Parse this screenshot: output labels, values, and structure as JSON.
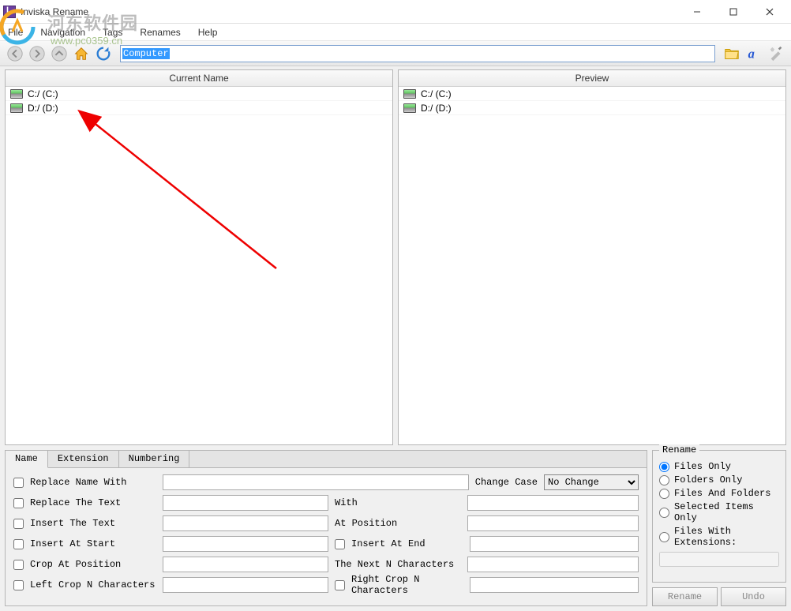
{
  "window": {
    "title": "Inviska Rename"
  },
  "menu": {
    "file": "File",
    "navigation": "Navigation",
    "tags": "Tags",
    "renames": "Renames",
    "help": "Help"
  },
  "toolbar": {
    "path_value": "Computer"
  },
  "panes": {
    "left_header": "Current Name",
    "right_header": "Preview",
    "drives": [
      {
        "label": "C:/ (C:)"
      },
      {
        "label": "D:/ (D:)"
      }
    ]
  },
  "tabs": {
    "name": "Name",
    "extension": "Extension",
    "numbering": "Numbering"
  },
  "name_tab": {
    "replace_name_with": "Replace Name With",
    "change_case": "Change Case",
    "change_case_value": "No Change",
    "replace_the_text": "Replace The Text",
    "with": "With",
    "insert_the_text": "Insert The Text",
    "at_position": "At Position",
    "insert_at_start": "Insert At Start",
    "insert_at_end": "Insert At End",
    "crop_at_position": "Crop At Position",
    "the_next_n": "The Next N Characters",
    "left_crop_n": "Left Crop N Characters",
    "right_crop_n": "Right Crop N Characters"
  },
  "rename_group": {
    "title": "Rename",
    "files_only": "Files Only",
    "folders_only": "Folders Only",
    "files_and_folders": "Files And Folders",
    "selected_items_only": "Selected Items Only",
    "files_with_extensions": "Files With Extensions:"
  },
  "buttons": {
    "rename": "Rename",
    "undo": "Undo"
  },
  "watermark": {
    "line1": "河东软件园",
    "line2": "www.pc0359.cn"
  }
}
